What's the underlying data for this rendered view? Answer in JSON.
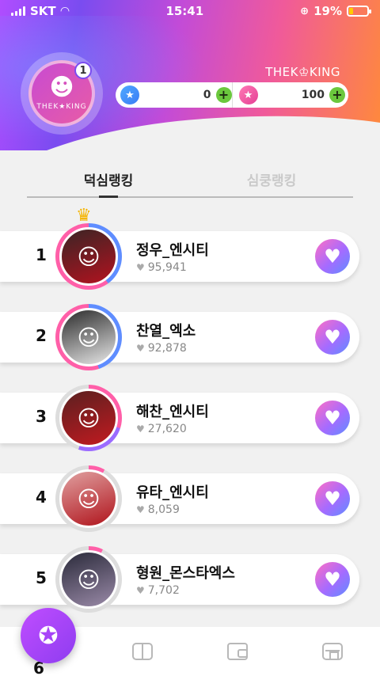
{
  "status": {
    "carrier": "SKT",
    "time": "15:41",
    "battery": "19%"
  },
  "profile": {
    "badge": "1",
    "logo_text": "THEK★KING"
  },
  "brand": "THEK♔KING",
  "currency": {
    "stars": "0",
    "hearts": "100"
  },
  "tabs": [
    {
      "label": "덕심랭킹"
    },
    {
      "label": "심쿵랭킹"
    }
  ],
  "ranking": [
    {
      "rank": "1",
      "name": "정우_엔시티",
      "likes": "95,941"
    },
    {
      "rank": "2",
      "name": "찬열_엑소",
      "likes": "92,878"
    },
    {
      "rank": "3",
      "name": "해찬_엔시티",
      "likes": "27,620"
    },
    {
      "rank": "4",
      "name": "유타_엔시티",
      "likes": "8,059"
    },
    {
      "rank": "5",
      "name": "형원_몬스타엑스",
      "likes": "7,702"
    }
  ],
  "peek_rank": "6",
  "colors": {
    "accent": "#a56bff",
    "plus": "#6bc83d"
  }
}
